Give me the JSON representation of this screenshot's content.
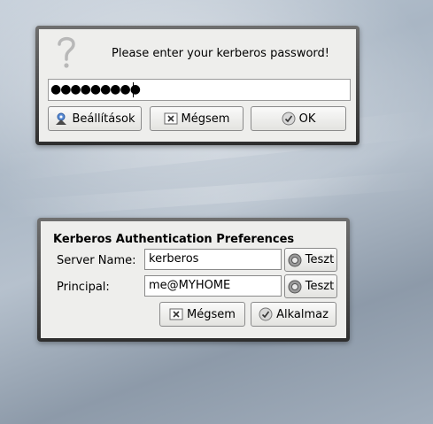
{
  "password_dialog": {
    "prompt": "Please enter your kerberos password!",
    "password_mask": "●●●●●●●●●",
    "settings_button": "Beállítások",
    "cancel_button": "Mégsem",
    "ok_button": "OK"
  },
  "prefs_dialog": {
    "title": "Kerberos Authentication Preferences",
    "server_label": "Server Name:",
    "server_value": "kerberos",
    "principal_label": "Principal:",
    "principal_value": "me@MYHOME",
    "test_button_1": "Teszt",
    "test_button_2": "Teszt",
    "cancel_button": "Mégsem",
    "apply_button": "Alkalmaz"
  },
  "icons": [
    "question-mark-icon",
    "settings-icon",
    "cancel-icon",
    "ok-icon",
    "test-icon",
    "apply-icon"
  ]
}
